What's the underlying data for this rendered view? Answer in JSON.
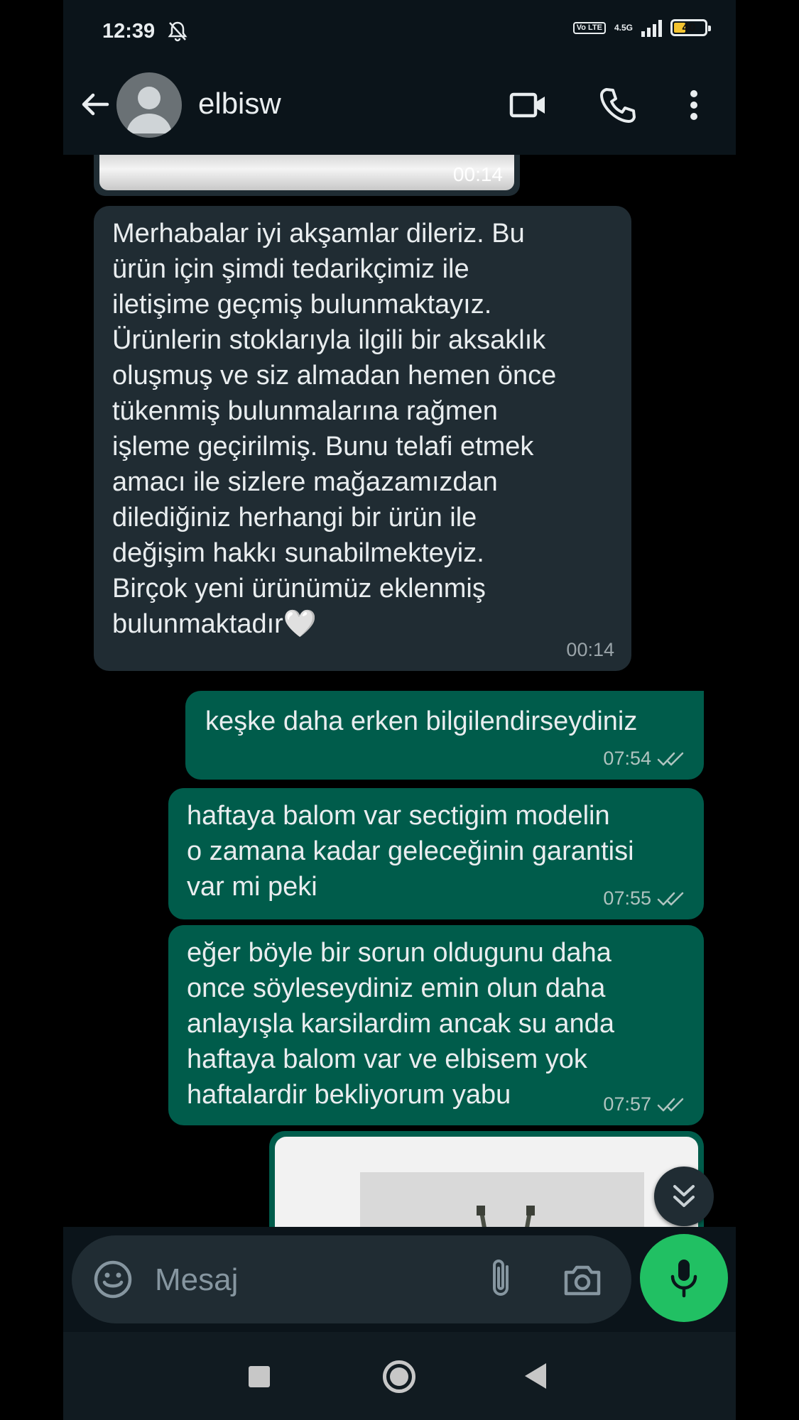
{
  "status_bar": {
    "time": "12:39",
    "volte": "Vo LTE",
    "network": "4.5G",
    "battery": "40",
    "battery_level": 0.4
  },
  "header": {
    "contact_name": "elbisw",
    "icons": [
      "back-arrow-icon",
      "avatar-placeholder-icon",
      "video-call-icon",
      "phone-icon",
      "more-vert-icon"
    ]
  },
  "messages": [
    {
      "direction": "in",
      "kind": "media",
      "time": "00:14"
    },
    {
      "direction": "in",
      "text": "Merhabalar iyi akşamlar dileriz. Bu\nürün için şimdi tedarikçimiz ile\niletişime geçmiş bulunmaktayız.\nÜrünlerin stoklarıyla ilgili bir aksaklık\noluşmuş ve siz almadan hemen önce\ntükenmiş bulunmalarına rağmen\nişleme geçirilmiş. Bunu telafi etmek\namacı ile sizlere mağazamızdan\ndilediğiniz herhangi bir ürün ile\ndeğişim hakkı sunabilmekteyiz.\nBirçok yeni ürünümüz eklenmiş\nbulunmaktadır🤍",
      "time": "00:14"
    },
    {
      "direction": "out",
      "text": "keşke daha erken bilgilendirseydiniz",
      "time": "07:54"
    },
    {
      "direction": "out",
      "text": "haftaya balom var sectigim modelin\no zamana kadar geleceğinin garantisi\nvar mi peki",
      "time": "07:55"
    },
    {
      "direction": "out",
      "text": "eğer böyle bir sorun oldugunu daha\nonce söyleseydiniz emin olun daha\nanlayışla karsilardim ancak su anda\nhaftaya balom var ve elbisem yok\nhaftalardir bekliyorum yabu",
      "time": "07:57"
    },
    {
      "direction": "out",
      "kind": "media"
    }
  ],
  "composer": {
    "placeholder": "Mesaj",
    "icons": [
      "emoji-icon",
      "attach-icon",
      "camera-icon",
      "mic-icon"
    ]
  },
  "colors": {
    "incoming_bubble": "#202c33",
    "outgoing_bubble": "#005c4b",
    "accent": "#21c063",
    "background": "#0b141a"
  },
  "nav": {
    "icons": [
      "recents-square-icon",
      "home-circle-icon",
      "back-triangle-icon"
    ]
  }
}
